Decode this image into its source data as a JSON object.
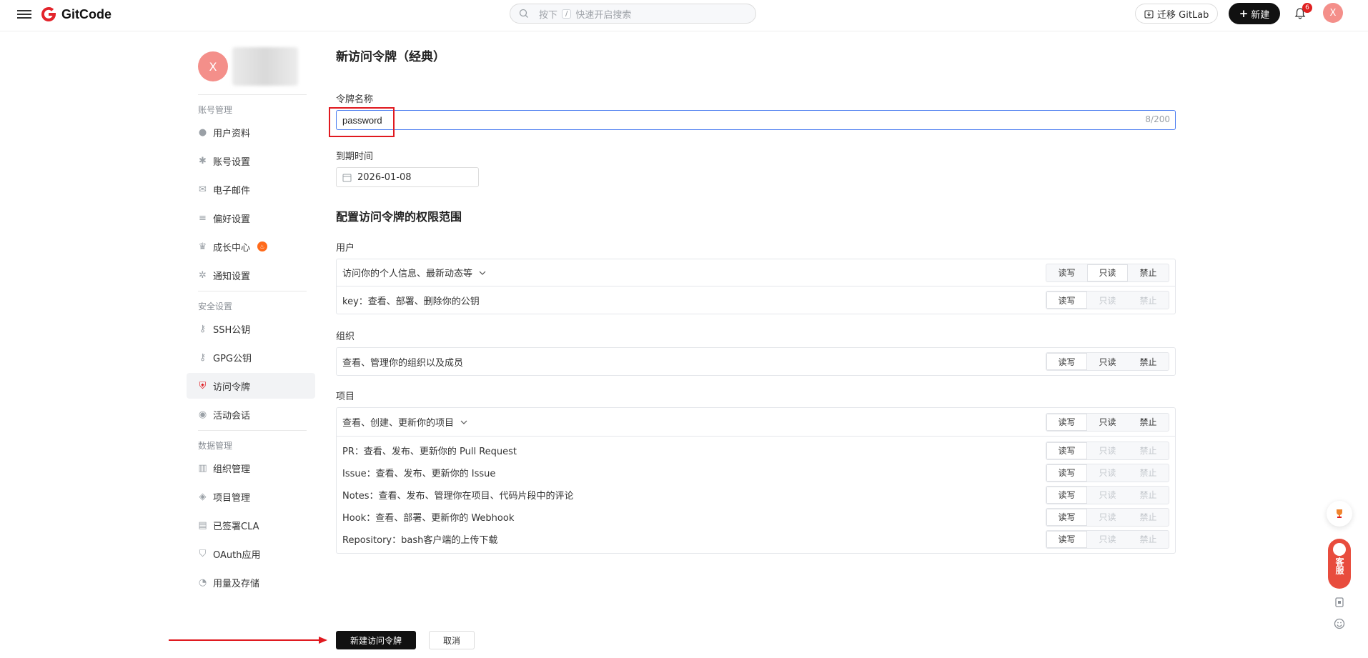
{
  "header": {
    "brand": "GitCode",
    "search_placeholder_prefix": "按下",
    "search_shortcut": "/",
    "search_placeholder_suffix": "快速开启搜索",
    "migrate_label": "迁移 GitLab",
    "new_label": "新建",
    "notification_count": "6",
    "avatar_initial": "X",
    "colors": {
      "brand_red": "#e3242b",
      "accent_blue": "#4a7cf0",
      "primary_dark": "#111111"
    }
  },
  "sidebar": {
    "avatar_initial": "X",
    "groups": [
      {
        "title": "账号管理",
        "items": [
          {
            "label": "用户资料",
            "icon": "user-icon"
          },
          {
            "label": "账号设置",
            "icon": "gear-icon"
          },
          {
            "label": "电子邮件",
            "icon": "mail-icon"
          },
          {
            "label": "偏好设置",
            "icon": "sliders-icon"
          },
          {
            "label": "成长中心",
            "icon": "trophy-icon",
            "badge": "fire-icon"
          },
          {
            "label": "通知设置",
            "icon": "bell-gear-icon"
          }
        ]
      },
      {
        "title": "安全设置",
        "items": [
          {
            "label": "SSH公钥",
            "icon": "key-icon"
          },
          {
            "label": "GPG公钥",
            "icon": "key-icon"
          },
          {
            "label": "访问令牌",
            "icon": "shield-icon",
            "active": true
          },
          {
            "label": "活动会话",
            "icon": "signal-icon"
          }
        ]
      },
      {
        "title": "数据管理",
        "items": [
          {
            "label": "组织管理",
            "icon": "building-icon"
          },
          {
            "label": "项目管理",
            "icon": "layers-icon"
          },
          {
            "label": "已签署CLA",
            "icon": "document-icon"
          },
          {
            "label": "OAuth应用",
            "icon": "shield-check-icon"
          },
          {
            "label": "用量及存储",
            "icon": "pie-icon"
          }
        ]
      }
    ]
  },
  "main": {
    "title": "新访问令牌（经典）",
    "name_label": "令牌名称",
    "name_value": "password",
    "name_counter": "8/200",
    "expiry_label": "到期时间",
    "expiry_value": "2026-01-08",
    "scope_title": "配置访问令牌的权限范围",
    "perm_options": [
      "读写",
      "只读",
      "禁止"
    ],
    "groups": [
      {
        "title": "用户",
        "head": {
          "desc": "访问你的个人信息、最新动态等",
          "expandable": true,
          "selected": "只读",
          "disabled": []
        },
        "rows": [
          {
            "desc": "key：查看、部署、删除你的公钥",
            "selected": "读写",
            "disabled": [
              "只读",
              "禁止"
            ]
          }
        ]
      },
      {
        "title": "组织",
        "head": {
          "desc": "查看、管理你的组织以及成员",
          "expandable": false,
          "selected": "读写",
          "disabled": []
        },
        "rows": []
      },
      {
        "title": "项目",
        "head": {
          "desc": "查看、创建、更新你的项目",
          "expandable": true,
          "selected": "读写",
          "disabled": []
        },
        "rows": [
          {
            "desc": "PR：查看、发布、更新你的 Pull Request",
            "selected": "读写",
            "disabled": [
              "只读",
              "禁止"
            ]
          },
          {
            "desc": "Issue：查看、发布、更新你的 Issue",
            "selected": "读写",
            "disabled": [
              "只读",
              "禁止"
            ]
          },
          {
            "desc": "Notes：查看、发布、管理你在项目、代码片段中的评论",
            "selected": "读写",
            "disabled": [
              "只读",
              "禁止"
            ]
          },
          {
            "desc": "Hook：查看、部署、更新你的 Webhook",
            "selected": "读写",
            "disabled": [
              "只读",
              "禁止"
            ]
          },
          {
            "desc": "Repository：bash客户端的上传下载",
            "selected": "读写",
            "disabled": [
              "只读",
              "禁止"
            ]
          }
        ]
      }
    ],
    "create_label": "新建访问令牌",
    "cancel_label": "取消"
  },
  "floating": {
    "service_label": "客服"
  }
}
